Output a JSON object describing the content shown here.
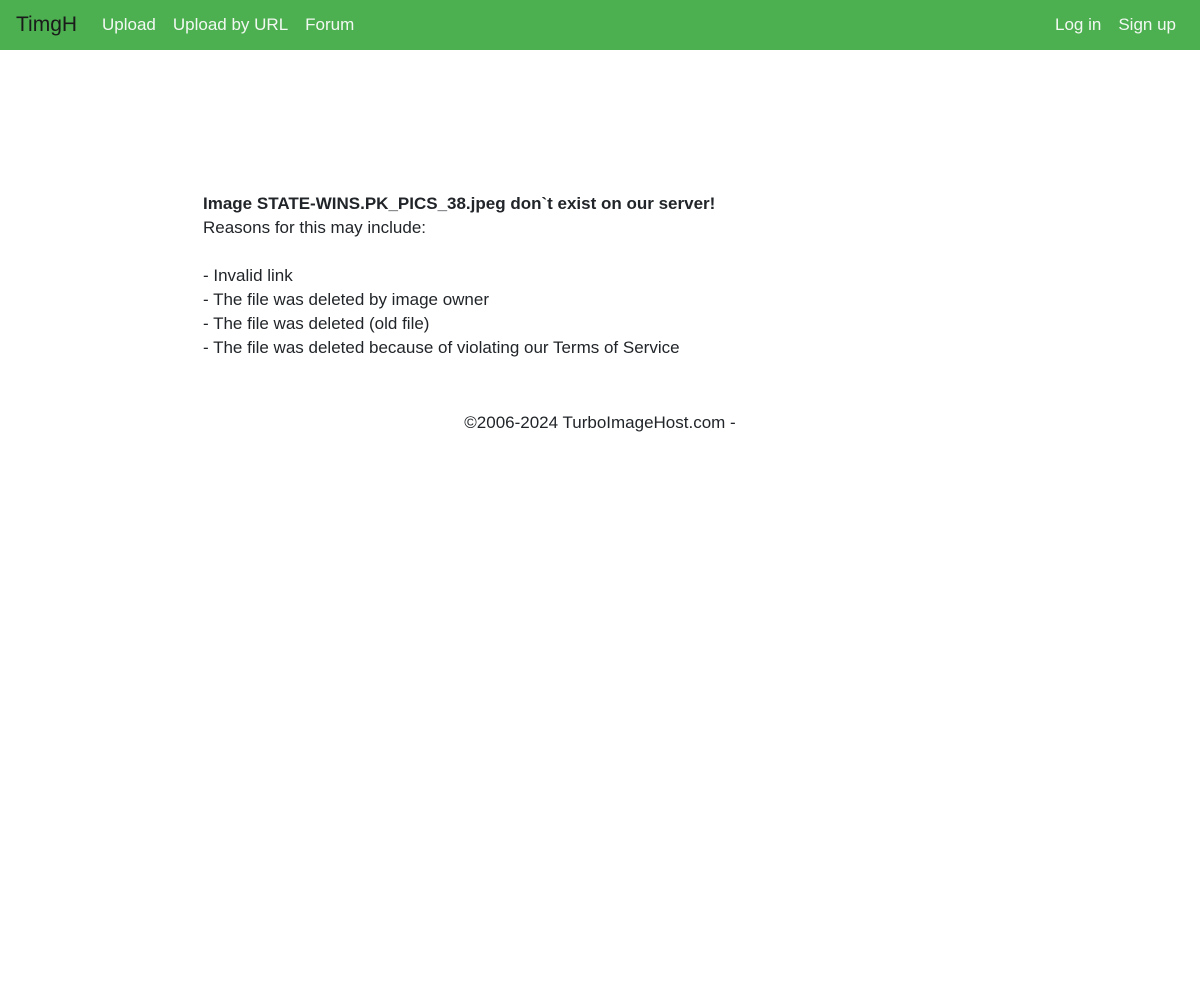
{
  "navbar": {
    "brand": "TimgH",
    "left_links": [
      "Upload",
      "Upload by URL",
      "Forum"
    ],
    "right_links": [
      "Log in",
      "Sign up"
    ],
    "background_color": "#4caf50"
  },
  "main": {
    "error_title": "Image STATE-WINS.PK_PICS_38.jpeg don`t exist on our server!",
    "reasons_intro": "Reasons for this may include:",
    "reasons": [
      "- Invalid link",
      "- The file was deleted by image owner",
      "- The file was deleted (old file)",
      "- The file was deleted because of violating our Terms of Service"
    ]
  },
  "footer": {
    "text": "©2006-2024 TurboImageHost.com -"
  }
}
